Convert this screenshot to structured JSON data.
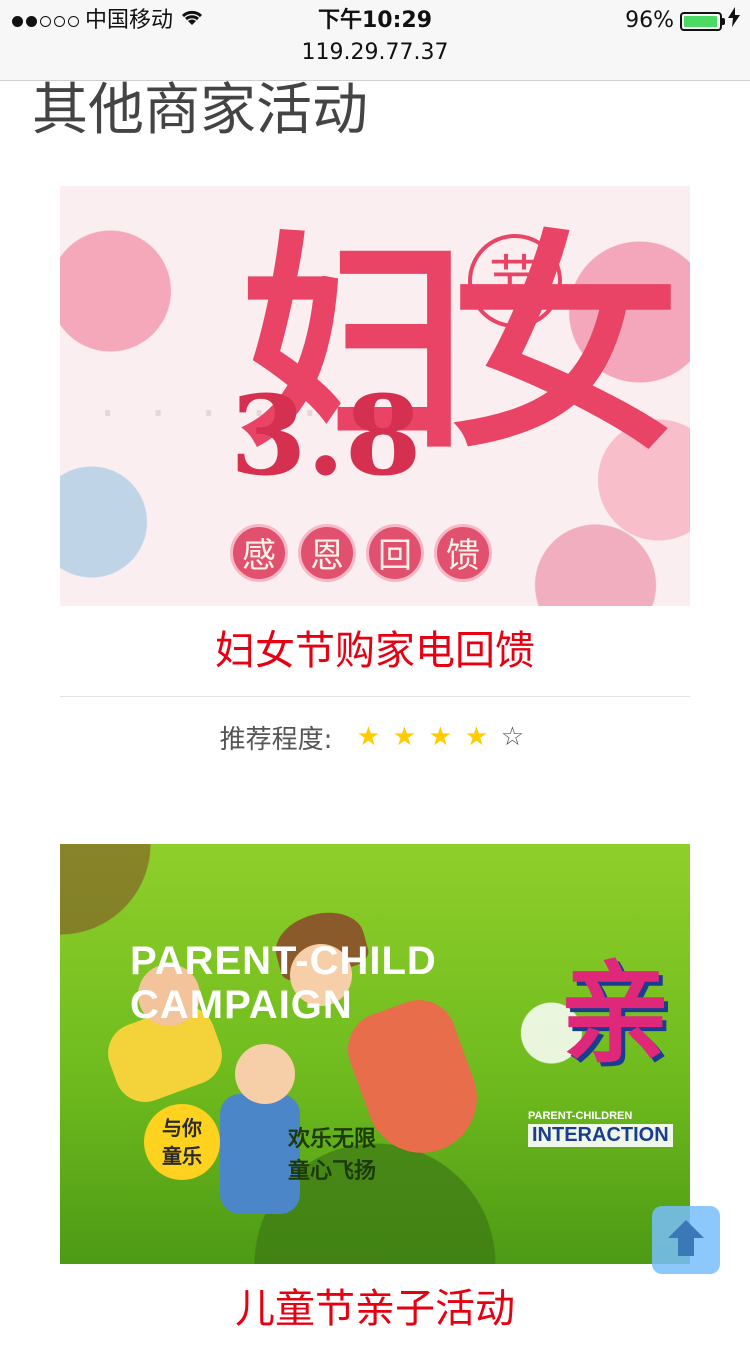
{
  "status_bar": {
    "carrier": "中国移动",
    "time": "下午10:29",
    "battery_percent_label": "96%",
    "battery_level": 0.96,
    "url": "119.29.77.37",
    "signal_icon": "signal-dots-icon",
    "wifi_icon": "wifi-icon",
    "charging_icon": "bolt-icon"
  },
  "page": {
    "title": "其他商家活动"
  },
  "activities": [
    {
      "title": "妇女节购家电回馈",
      "rating_label": "推荐程度:",
      "rating": 4,
      "rating_max": 5,
      "banner": {
        "big_text": "妇女",
        "number": "3.8",
        "seal": "节",
        "pills": [
          "感",
          "恩",
          "回",
          "馈"
        ]
      }
    },
    {
      "title": "儿童节亲子活动",
      "banner": {
        "english_title": "PARENT-CHILD\nCAMPAIGN",
        "tag": "与你\n童乐",
        "slogan": "欢乐无限\n童心飞扬",
        "big_text": "亲",
        "parent_children": "PARENT-CHILDREN",
        "interaction": "INTERACTION"
      }
    }
  ],
  "back_to_top": {
    "icon": "arrow-up-icon"
  },
  "colors": {
    "title_red": "#e60012",
    "star_yellow": "#ffcc00",
    "battery_green": "#4cd964",
    "back_top_blue": "#78befa"
  }
}
